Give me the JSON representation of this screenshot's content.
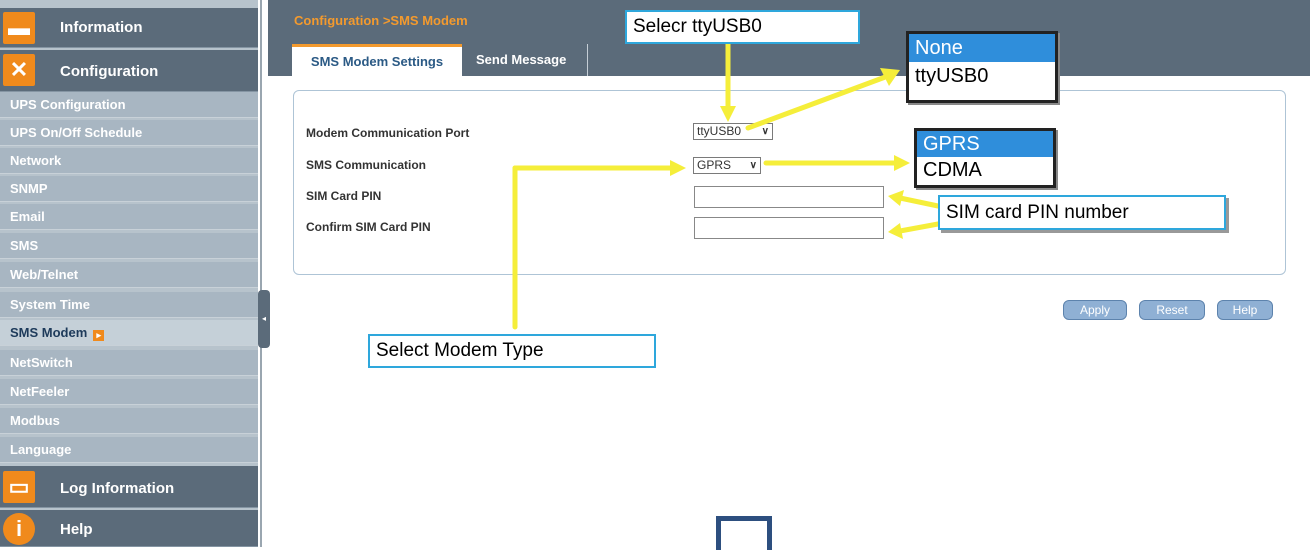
{
  "sidebar": {
    "headers": {
      "information": "Information",
      "configuration": "Configuration",
      "log_information": "Log Information",
      "help": "Help"
    },
    "items": [
      {
        "label": "UPS Configuration"
      },
      {
        "label": "UPS On/Off Schedule"
      },
      {
        "label": "Network"
      },
      {
        "label": "SNMP"
      },
      {
        "label": "Email"
      },
      {
        "label": "SMS"
      },
      {
        "label": "Web/Telnet"
      },
      {
        "label": "System Time"
      },
      {
        "label": "SMS Modem"
      },
      {
        "label": "NetSwitch"
      },
      {
        "label": "NetFeeler"
      },
      {
        "label": "Modbus"
      },
      {
        "label": "Language"
      }
    ]
  },
  "breadcrumb": "Configuration >SMS Modem",
  "tabs": {
    "active": "SMS Modem Settings",
    "inactive": "Send Message"
  },
  "form": {
    "port_label": "Modem Communication Port",
    "port_value": "ttyUSB0",
    "comm_label": "SMS Communication",
    "comm_value": "GPRS",
    "pin_label": "SIM Card PIN",
    "confirm_pin_label": "Confirm SIM Card PIN"
  },
  "buttons": {
    "apply": "Apply",
    "reset": "Reset",
    "help": "Help"
  },
  "annotations": {
    "select_port": "Selecr ttyUSB0",
    "port_options": [
      "None",
      "ttyUSB0"
    ],
    "comm_options": [
      "GPRS",
      "CDMA"
    ],
    "pin_note": "SIM card PIN number",
    "modem_type": "Select Modem Type"
  },
  "colors": {
    "accent": "#f39a2e",
    "band": "#5b6b7a",
    "annotation_arrow": "#f5ee3a",
    "callout_border": "#2ea7dc"
  }
}
